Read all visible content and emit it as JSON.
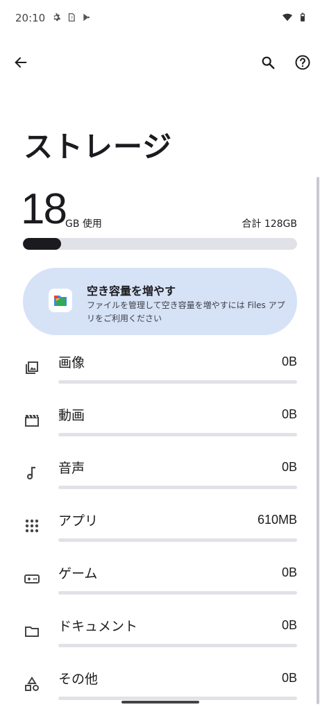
{
  "status_bar": {
    "time": "20:10",
    "left_icons": [
      "settings-icon",
      "sim-alert-icon",
      "play-store-icon"
    ],
    "right_icons": [
      "wifi-icon",
      "battery-icon"
    ]
  },
  "app_bar": {
    "back_icon": "arrow-back-icon",
    "search_icon": "search-icon",
    "help_icon": "help-icon"
  },
  "page": {
    "title": "ストレージ"
  },
  "summary": {
    "used_value": "18",
    "used_unit": "GB 使用",
    "total": "合計 128GB",
    "used_fraction": 0.14
  },
  "promo": {
    "title": "空き容量を増やす",
    "description": "ファイルを管理して空き容量を増やすには Files アプリをご利用ください",
    "icon": "files-app-icon"
  },
  "categories": [
    {
      "icon": "image-icon",
      "label": "画像",
      "value": "0B",
      "fraction": 0
    },
    {
      "icon": "movie-icon",
      "label": "動画",
      "value": "0B",
      "fraction": 0
    },
    {
      "icon": "music-note-icon",
      "label": "音声",
      "value": "0B",
      "fraction": 0
    },
    {
      "icon": "apps-grid-icon",
      "label": "アプリ",
      "value": "610MB",
      "fraction": 0
    },
    {
      "icon": "gamepad-icon",
      "label": "ゲーム",
      "value": "0B",
      "fraction": 0
    },
    {
      "icon": "folder-icon",
      "label": "ドキュメント",
      "value": "0B",
      "fraction": 0
    },
    {
      "icon": "shapes-icon",
      "label": "その他",
      "value": "0B",
      "fraction": 0
    }
  ]
}
